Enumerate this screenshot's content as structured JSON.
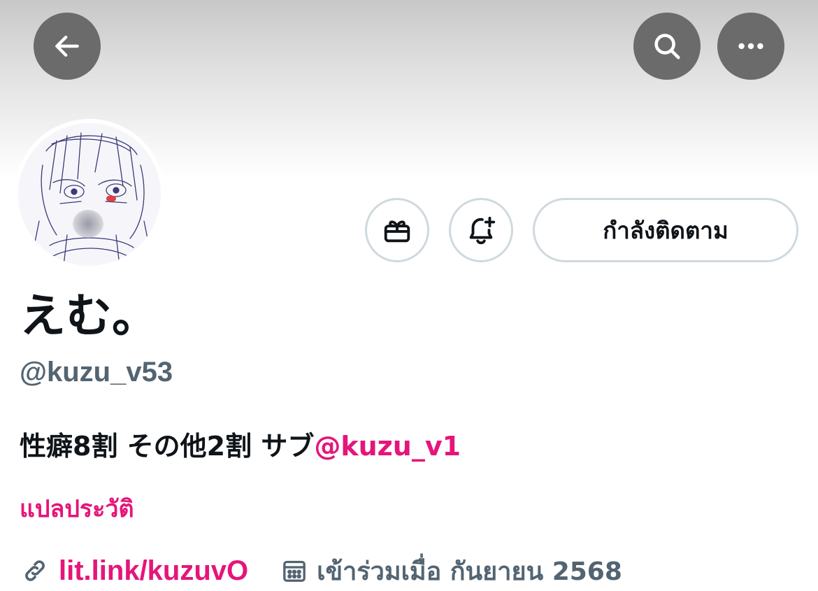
{
  "header": {
    "back_icon": "arrow-left-icon",
    "search_icon": "search-icon",
    "more_icon": "more-horizontal-icon"
  },
  "actions": {
    "gift_icon": "gift-icon",
    "notify_icon": "bell-plus-icon",
    "following_label": "กำลังติดตาม"
  },
  "profile": {
    "display_name": "えむ。",
    "handle": "@kuzu_v53",
    "bio_text": "性癖8割 その他2割 サブ",
    "bio_mention": "@kuzu_v1",
    "translate_label": "แปลประวัติ",
    "link": "lit.link/kuzuvO",
    "joined": "เข้าร่วมเมื่อ กันยายน 2568"
  },
  "colors": {
    "accent": "#e5157a",
    "secondary_text": "#536471",
    "primary_text": "#0f1419",
    "button_border": "#cfd9de",
    "overlay_button": "#6b6b6b"
  }
}
